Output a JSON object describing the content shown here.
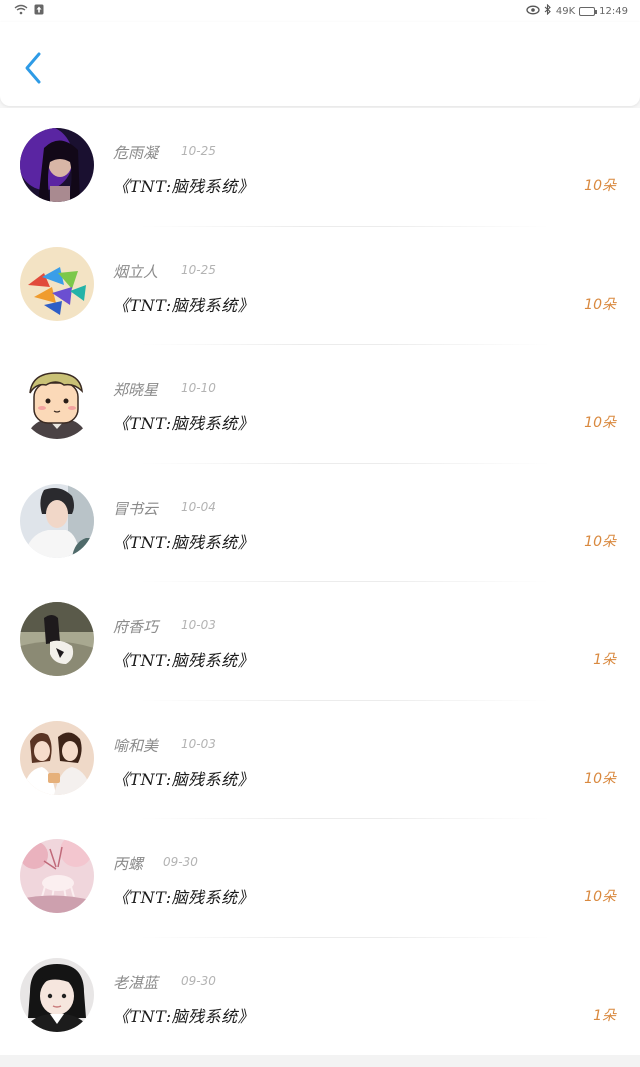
{
  "status_bar": {
    "network_speed": "49K",
    "time": "12:49"
  },
  "colors": {
    "accent": "#2e9be6",
    "count": "#d9893f"
  },
  "items": [
    {
      "name": "危雨凝",
      "date": "10-25",
      "title": "《TNT:脑残系统》",
      "count": "10朵"
    },
    {
      "name": "烟立人",
      "date": "10-25",
      "title": "《TNT:脑残系统》",
      "count": "10朵"
    },
    {
      "name": "郑晓星",
      "date": "10-10",
      "title": "《TNT:脑残系统》",
      "count": "10朵"
    },
    {
      "name": "冒书云",
      "date": "10-04",
      "title": "《TNT:脑残系统》",
      "count": "10朵"
    },
    {
      "name": "府香巧",
      "date": "10-03",
      "title": "《TNT:脑残系统》",
      "count": "1朵"
    },
    {
      "name": "喻和美",
      "date": "10-03",
      "title": "《TNT:脑残系统》",
      "count": "10朵"
    },
    {
      "name": "丙螺",
      "date": "09-30",
      "title": "《TNT:脑残系统》",
      "count": "10朵"
    },
    {
      "name": "老湛蓝",
      "date": "09-30",
      "title": "《TNT:脑残系统》",
      "count": "1朵"
    }
  ]
}
